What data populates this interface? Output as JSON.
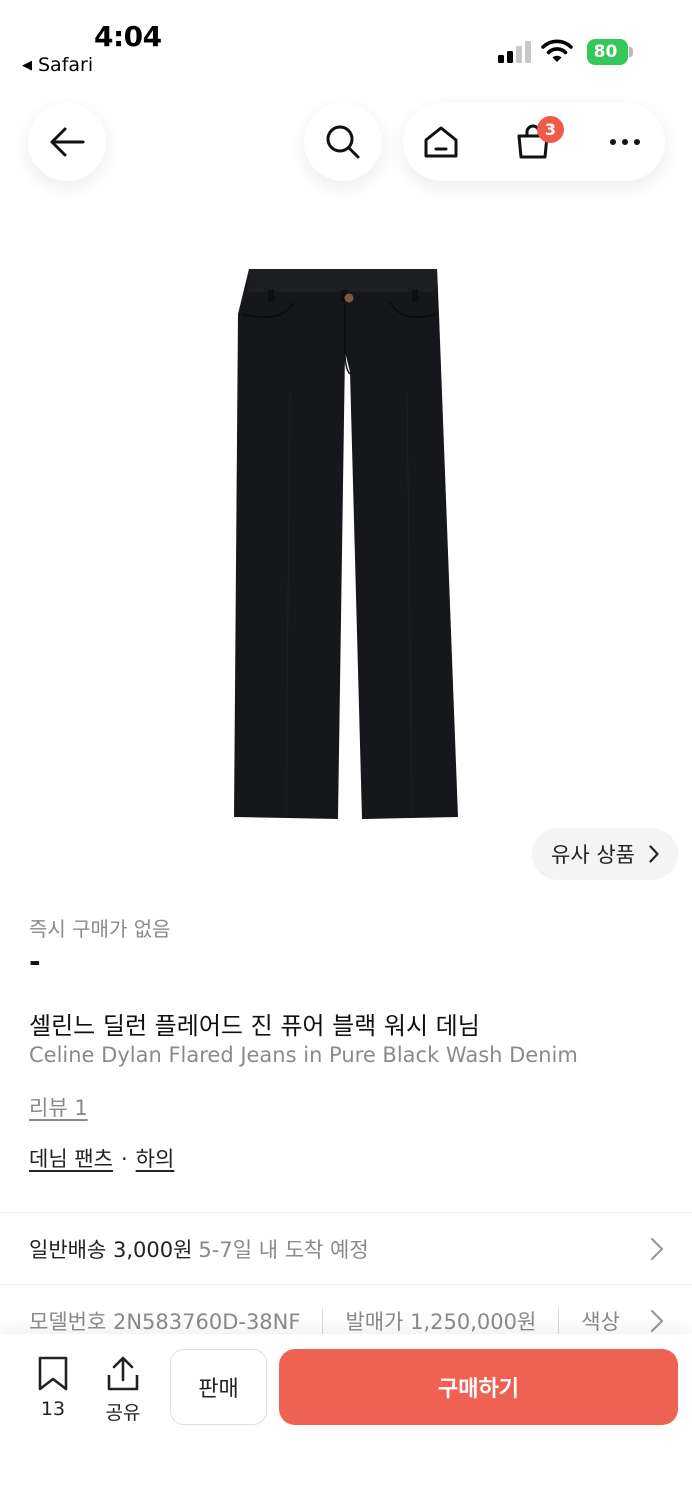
{
  "status_bar": {
    "time": "4:04",
    "back_app": "Safari",
    "battery": "80"
  },
  "nav": {
    "cart_count": "3"
  },
  "product": {
    "similar_label": "유사 상품",
    "instant_purchase": "즉시 구매가 없음",
    "price": "-",
    "title_ko": "셀린느 딜런 플레어드 진 퓨어 블랙 워시 데님",
    "title_en": "Celine Dylan Flared Jeans in Pure Black Wash Denim",
    "review": "리뷰 1",
    "category_1": "데님 팬츠",
    "category_sep": "·",
    "category_2": "하의"
  },
  "shipping": {
    "main": "일반배송 3,000원",
    "sub": "5-7일 내 도착 예정"
  },
  "details": {
    "model": "모델번호 2N583760D-38NF",
    "release_price": "발매가 1,250,000원",
    "color": "색상"
  },
  "bottom_bar": {
    "save_count": "13",
    "share_label": "공유",
    "sell_label": "판매",
    "buy_label": "구매하기"
  },
  "colors": {
    "accent": "#ef6253",
    "badge": "#f05a4b",
    "battery": "#34c759"
  },
  "icons": [
    "back-arrow-icon",
    "search-icon",
    "home-icon",
    "shopping-bag-icon",
    "more-icon",
    "chevron-right-icon",
    "bookmark-icon",
    "share-icon"
  ]
}
